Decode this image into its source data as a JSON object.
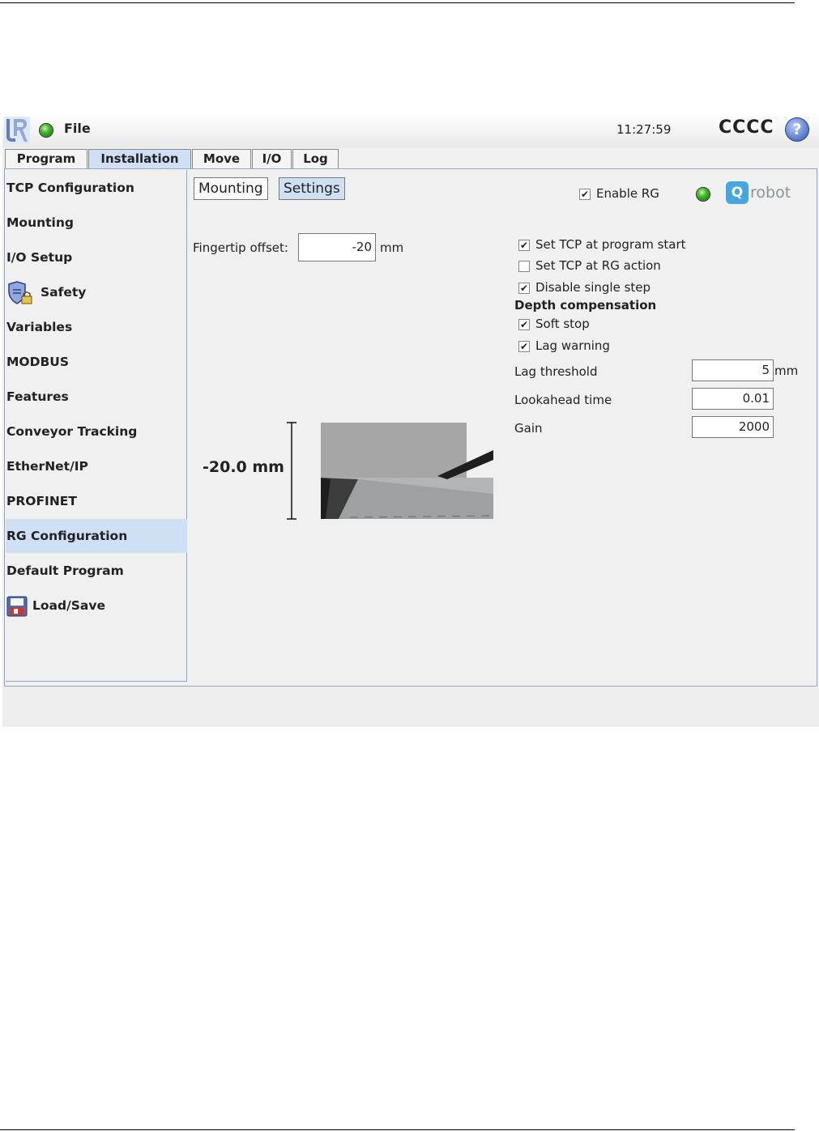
{
  "header": {
    "file_label": "File",
    "time": "11:27:59",
    "robot_name": "CCCC",
    "help_glyph": "?",
    "icons": {
      "logo": "ur-logo-icon",
      "status": "status-led-icon",
      "help": "help-icon"
    },
    "colors": {
      "led_green": "#3eb528",
      "help_blue": "#5577cc"
    }
  },
  "tabs": [
    {
      "label": "Program",
      "active": false
    },
    {
      "label": "Installation",
      "active": true
    },
    {
      "label": "Move",
      "active": false
    },
    {
      "label": "I/O",
      "active": false
    },
    {
      "label": "Log",
      "active": false
    }
  ],
  "sidebar": {
    "items": [
      {
        "label": "TCP Configuration"
      },
      {
        "label": "Mounting"
      },
      {
        "label": "I/O Setup"
      },
      {
        "label": "Safety",
        "icon": "shield-lock-icon"
      },
      {
        "label": "Variables"
      },
      {
        "label": "MODBUS"
      },
      {
        "label": "Features"
      },
      {
        "label": "Conveyor Tracking"
      },
      {
        "label": "EtherNet/IP"
      },
      {
        "label": "PROFINET"
      },
      {
        "label": "RG Configuration",
        "active": true
      },
      {
        "label": "Default Program"
      },
      {
        "label": "Load/Save",
        "icon": "floppy-disk-icon"
      }
    ],
    "active_color": "#cfe0f5"
  },
  "rg": {
    "subtabs": [
      {
        "label": "Mounting",
        "active": false
      },
      {
        "label": "Settings",
        "active": true
      }
    ],
    "enable_rg": {
      "label": "Enable RG",
      "checked": true
    },
    "brand": {
      "badge": "Q",
      "word": "robot",
      "icon": "onrobot-logo-icon",
      "color": "#45a6e0"
    },
    "fingertip": {
      "label": "Fingertip offset:",
      "value": "-20",
      "unit": "mm"
    },
    "options": [
      {
        "label": "Set TCP at program start",
        "checked": true
      },
      {
        "label": "Set TCP at RG action",
        "checked": false
      },
      {
        "label": "Disable single step",
        "checked": true
      }
    ],
    "depth": {
      "heading": "Depth compensation",
      "options": [
        {
          "label": "Soft stop",
          "checked": true
        },
        {
          "label": "Lag warning",
          "checked": true
        }
      ],
      "fields": [
        {
          "label": "Lag threshold",
          "value": "5",
          "unit": "mm"
        },
        {
          "label": "Lookahead time",
          "value": "0.01",
          "unit": ""
        },
        {
          "label": "Gain",
          "value": "2000",
          "unit": ""
        }
      ]
    },
    "visual": {
      "dimension": "-20.0 mm"
    }
  }
}
